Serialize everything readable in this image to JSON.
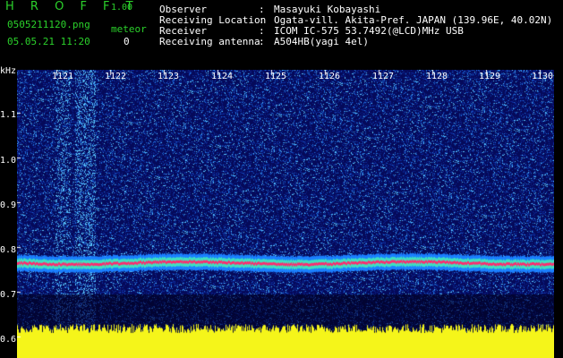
{
  "header": {
    "brand": "H R O F F T",
    "version": "1.00",
    "filename": "0505211120.png",
    "datetime": "05.05.21 11:20",
    "meteor_label": "meteor",
    "meteor_count": "0"
  },
  "info": {
    "rows": [
      {
        "label": "Observer",
        "value": "Masayuki Kobayashi"
      },
      {
        "label": "Receiving Location",
        "value": "Ogata-vill. Akita-Pref. JAPAN (139.96E, 40.02N)"
      },
      {
        "label": "Receiver",
        "value": "ICOM IC-575 53.7492(@LCD)MHz USB"
      },
      {
        "label": "Receiving antenna",
        "value": "A504HB(yagi 4el)"
      }
    ],
    "colon": ":"
  },
  "axes": {
    "y_unit": "kHz",
    "y_ticks": [
      "1.1",
      "1.0",
      "0.9",
      "0.8",
      "0.7",
      "0.6"
    ],
    "x_ticks": [
      "1121",
      "1122",
      "1123",
      "1124",
      "1125",
      "1126",
      "1127",
      "1128",
      "1129",
      "1130"
    ]
  },
  "colors": {
    "text_green": "#2bd12b",
    "background": "#050a5a",
    "signal_line": "#ff2a6e",
    "noise_floor": "#f5f51a"
  }
}
